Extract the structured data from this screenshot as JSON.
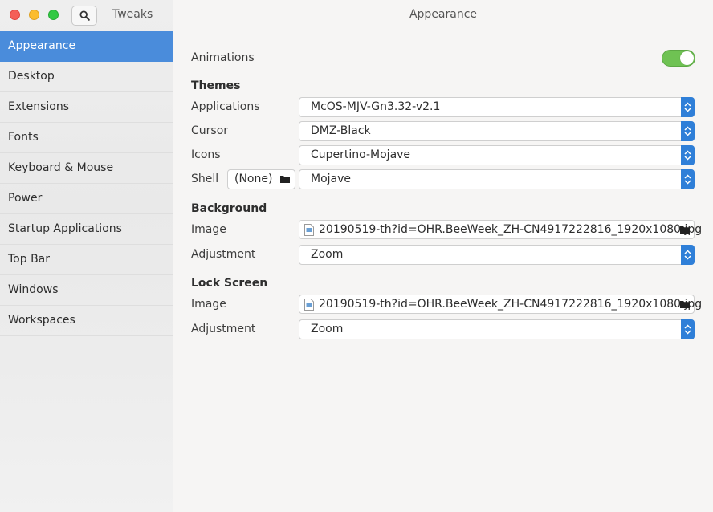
{
  "app": {
    "title": "Tweaks"
  },
  "window": {
    "title": "Appearance"
  },
  "sidebar": {
    "items": [
      {
        "label": "Appearance",
        "selected": true
      },
      {
        "label": "Desktop"
      },
      {
        "label": "Extensions"
      },
      {
        "label": "Fonts"
      },
      {
        "label": "Keyboard & Mouse"
      },
      {
        "label": "Power"
      },
      {
        "label": "Startup Applications"
      },
      {
        "label": "Top Bar"
      },
      {
        "label": "Windows"
      },
      {
        "label": "Workspaces"
      }
    ]
  },
  "appearance": {
    "animations": {
      "label": "Animations",
      "enabled": true
    },
    "themes": {
      "heading": "Themes",
      "applications": {
        "label": "Applications",
        "value": "McOS-MJV-Gn3.32-v2.1"
      },
      "cursor": {
        "label": "Cursor",
        "value": "DMZ-Black"
      },
      "icons": {
        "label": "Icons",
        "value": "Cupertino-Mojave"
      },
      "shell": {
        "label": "Shell",
        "file_value": "(None)",
        "value": "Mojave"
      }
    },
    "background": {
      "heading": "Background",
      "image": {
        "label": "Image",
        "value": "20190519-th?id=OHR.BeeWeek_ZH-CN4917222816_1920x1080.jpg"
      },
      "adjustment": {
        "label": "Adjustment",
        "value": "Zoom"
      }
    },
    "lock_screen": {
      "heading": "Lock Screen",
      "image": {
        "label": "Image",
        "value": "20190519-th?id=OHR.BeeWeek_ZH-CN4917222816_1920x1080.jpg"
      },
      "adjustment": {
        "label": "Adjustment",
        "value": "Zoom"
      }
    }
  },
  "colors": {
    "accent": "#4a8cdb",
    "toggle_on": "#6fc253",
    "combo_arrow": "#2f7fd8"
  },
  "icons": {
    "close": "close-icon",
    "minimize": "minimize-icon",
    "maximize": "maximize-icon",
    "search": "search-icon",
    "folder": "folder-icon",
    "image_file": "image-file-icon",
    "combo_arrows": "up-down-arrows-icon"
  }
}
